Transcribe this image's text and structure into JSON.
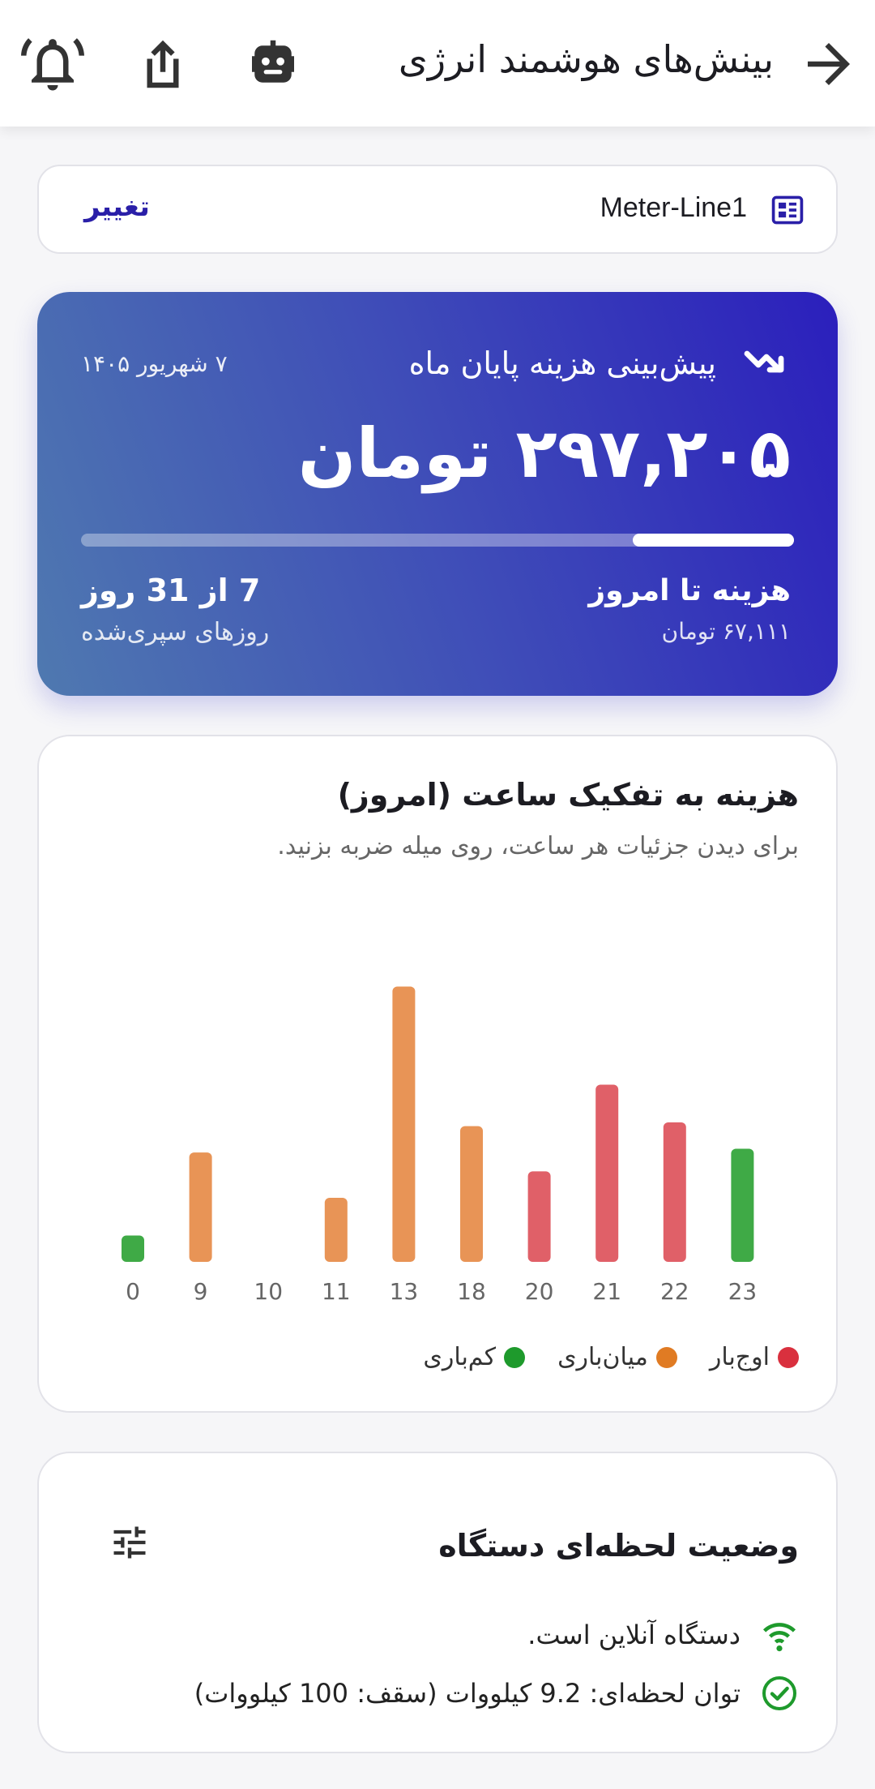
{
  "appbar": {
    "title": "بینش‌های هوشمند انرژی",
    "icons": [
      "back-arrow-icon",
      "robot-icon",
      "share-icon",
      "bell-icon"
    ]
  },
  "meter": {
    "name": "Meter-Line1",
    "change_label": "تغییر"
  },
  "forecast": {
    "title": "پیش‌بینی هزینه پایان ماه",
    "date": "۷ شهریور ۱۴۰۵",
    "amount": "۲۹۷,۲۰۵ تومان",
    "progress_fraction": 0.226,
    "cost_to_date_label": "هزینه تا امروز",
    "cost_to_date_value": "۶۷,۱۱۱ تومان",
    "days_label": "7 از 31 روز",
    "days_sub": "روزهای سپری‌شده"
  },
  "chart_card": {
    "title": "هزینه به تفکیک ساعت (امروز)",
    "subtitle": "برای دیدن جزئیات هر ساعت، روی میله ضربه بزنید.",
    "legend": [
      {
        "label": "اوج‌بار",
        "color": "#d9303e"
      },
      {
        "label": "میان‌باری",
        "color": "#e07b23"
      },
      {
        "label": "کم‌باری",
        "color": "#1e9a2c"
      }
    ]
  },
  "chart_data": {
    "type": "bar",
    "categories": [
      "0",
      "9",
      "10",
      "11",
      "13",
      "18",
      "20",
      "21",
      "22",
      "23"
    ],
    "values": [
      7,
      29,
      0,
      17,
      73,
      36,
      24,
      47,
      37,
      30
    ],
    "tariff": [
      "low",
      "mid",
      "none",
      "mid",
      "mid",
      "mid",
      "peak",
      "peak",
      "peak",
      "low"
    ],
    "colors": {
      "low": "#3faa46",
      "mid": "#e89456",
      "peak": "#e06068"
    },
    "ylim": [
      0,
      80
    ]
  },
  "device": {
    "title": "وضعیت لحظه‌ای دستگاه",
    "online_text": "دستگاه آنلاین است.",
    "power_text": "توان لحظه‌ای: 9.2 کیلووات (سقف: 100 کیلووات)",
    "online_color": "#1e9a2c"
  }
}
